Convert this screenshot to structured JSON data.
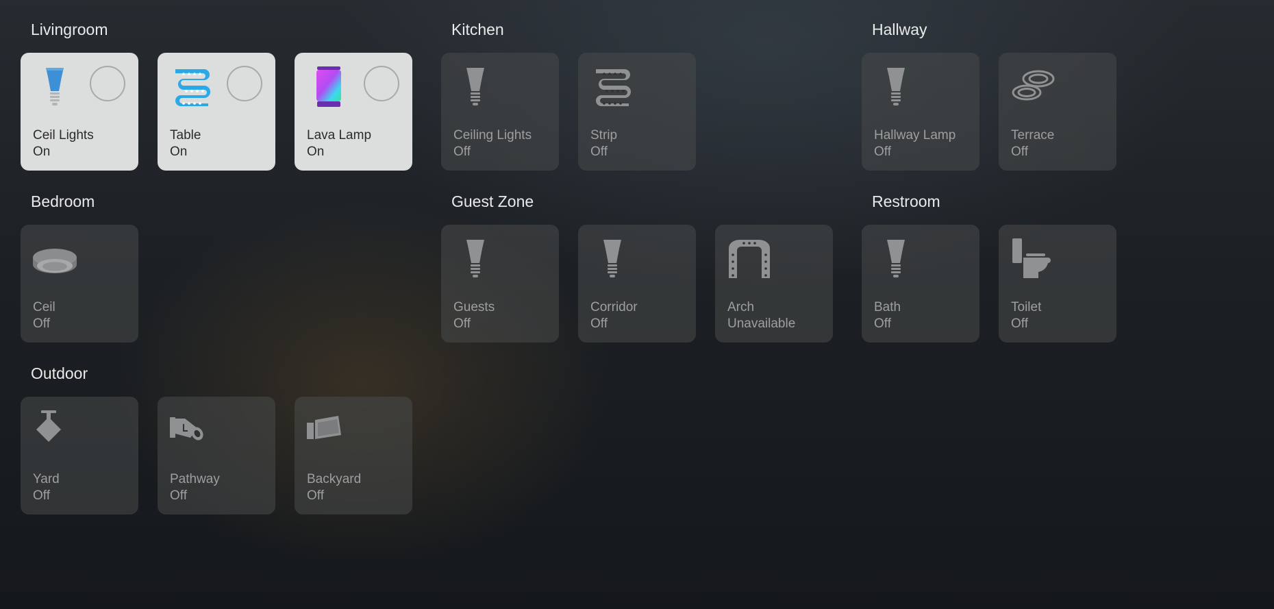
{
  "colors": {
    "off_icon": "#8f9192",
    "on_tile": "#dcdddd",
    "accent_blue": "#29a9e8"
  },
  "rooms": {
    "livingroom": {
      "title": "Livingroom",
      "devices": [
        {
          "name": "Ceil Lights",
          "state": "On",
          "icon": "bulb-icon"
        },
        {
          "name": "Table",
          "state": "On",
          "icon": "lightstrip-icon"
        },
        {
          "name": "Lava Lamp",
          "state": "On",
          "icon": "lava-lamp-icon"
        }
      ]
    },
    "kitchen": {
      "title": "Kitchen",
      "devices": [
        {
          "name": "Ceiling Lights",
          "state": "Off",
          "icon": "bulb-icon"
        },
        {
          "name": "Strip",
          "state": "Off",
          "icon": "lightstrip-icon"
        }
      ]
    },
    "hallway": {
      "title": "Hallway",
      "devices": [
        {
          "name": "Hallway Lamp",
          "state": "Off",
          "icon": "bulb-icon"
        },
        {
          "name": "Terrace",
          "state": "Off",
          "icon": "recessed-lights-icon"
        }
      ]
    },
    "bedroom": {
      "title": "Bedroom",
      "devices": [
        {
          "name": "Ceil",
          "state": "Off",
          "icon": "ceiling-lamp-icon"
        }
      ]
    },
    "guestzone": {
      "title": "Guest Zone",
      "devices": [
        {
          "name": "Guests",
          "state": "Off",
          "icon": "bulb-icon"
        },
        {
          "name": "Corridor",
          "state": "Off",
          "icon": "bulb-icon"
        },
        {
          "name": "Arch",
          "state": "Unavailable",
          "icon": "arch-icon"
        }
      ]
    },
    "restroom": {
      "title": "Restroom",
      "devices": [
        {
          "name": "Bath",
          "state": "Off",
          "icon": "bulb-icon"
        },
        {
          "name": "Toilet",
          "state": "Off",
          "icon": "toilet-icon"
        }
      ]
    },
    "outdoor": {
      "title": "Outdoor",
      "devices": [
        {
          "name": "Yard",
          "state": "Off",
          "icon": "spot-icon"
        },
        {
          "name": "Pathway",
          "state": "Off",
          "icon": "pathway-icon"
        },
        {
          "name": "Backyard",
          "state": "Off",
          "icon": "floodlight-icon"
        }
      ]
    }
  }
}
